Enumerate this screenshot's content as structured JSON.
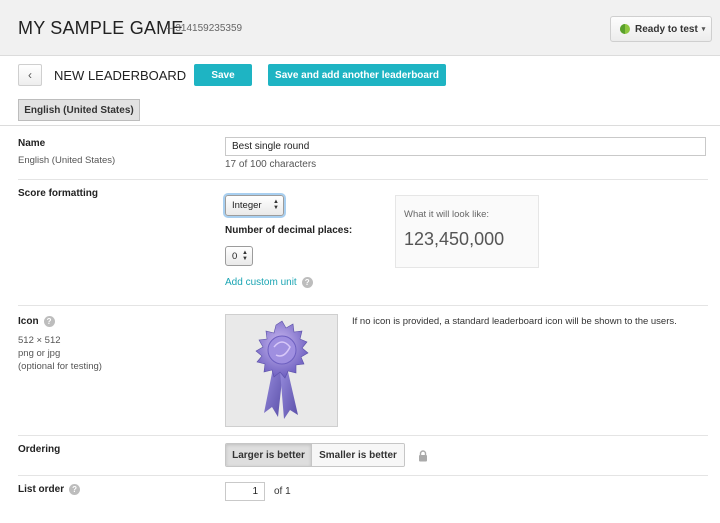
{
  "header": {
    "app_title": "MY SAMPLE GAME",
    "app_id": "– 314159235359",
    "status_label": "Ready to test",
    "status_caret": "▾"
  },
  "toolbar": {
    "back_glyph": "‹",
    "page_title": "NEW LEADERBOARD",
    "save_label": "Save",
    "save_add_label": "Save and add another leaderboard"
  },
  "language_tab": "English (United States)",
  "name_section": {
    "label": "Name",
    "sublabel": "English (United States)",
    "value": "Best single round",
    "char_count": "17 of 100 characters"
  },
  "score_formatting": {
    "label": "Score formatting",
    "format_value": "Integer",
    "decimal_label": "Number of decimal places:",
    "decimal_value": "0",
    "custom_unit_link": "Add custom unit",
    "preview_label": "What it will look like:",
    "preview_value": "123,450,000"
  },
  "icon_section": {
    "label": "Icon",
    "size": "512 × 512",
    "formats": "png or jpg",
    "optional": "(optional for testing)",
    "note": "If no icon is provided, a standard leaderboard icon will be shown to the users.",
    "icon_name": "award-ribbon-icon"
  },
  "ordering": {
    "label": "Ordering",
    "options": [
      "Larger is better",
      "Smaller is better"
    ],
    "selected": "Larger is better"
  },
  "list_order": {
    "label": "List order",
    "value": "1",
    "of_text": "of 1"
  },
  "help_glyph": "?",
  "colors": {
    "accent": "#1eb4c3",
    "link": "#1ba5b3",
    "status_green": "#8dc63f",
    "ribbon_purple": "#7a6fc4"
  }
}
